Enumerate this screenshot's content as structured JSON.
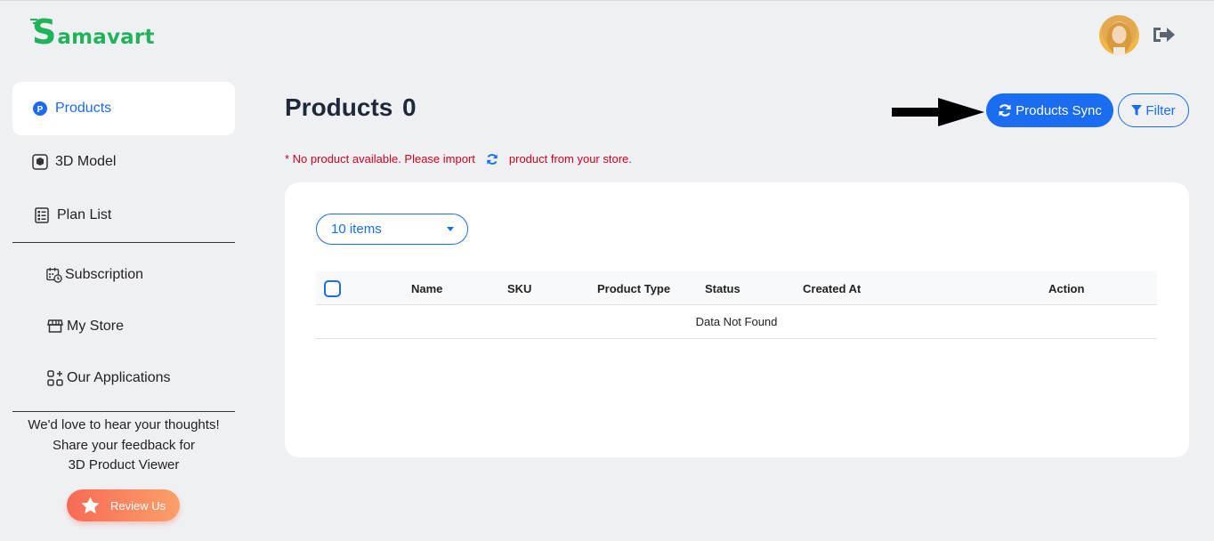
{
  "brand": {
    "logo_initial": "S",
    "logo_rest": "amavart",
    "color": "#1fb45a"
  },
  "header": {
    "avatar_icon": "user-avatar",
    "logout_icon": "logout-icon"
  },
  "sidebar": {
    "items": [
      {
        "label": "Products",
        "icon": "products-p-icon",
        "active": true
      },
      {
        "label": "3D Model",
        "icon": "cube-icon"
      },
      {
        "label": "Plan List",
        "icon": "list-icon"
      },
      {
        "label": "Subscription",
        "icon": "calendar-clock-icon"
      },
      {
        "label": "My Store",
        "icon": "store-icon"
      },
      {
        "label": "Our Applications",
        "icon": "apps-icon"
      }
    ],
    "feedback": {
      "line1": "We'd love to hear your thoughts!",
      "line2": "Share your feedback for",
      "line3": "3D Product Viewer"
    },
    "review_label": "Review Us"
  },
  "main": {
    "title": "Products",
    "count": "0",
    "sync_label": "Products Sync",
    "filter_label": "Filter",
    "notice_before": "* No product available. Please import",
    "notice_after": "product from your store.",
    "page_size": "10 items",
    "table": {
      "columns": [
        "Name",
        "SKU",
        "Product Type",
        "Status",
        "Created At",
        "Action"
      ],
      "empty_text": "Data Not Found"
    }
  },
  "colors": {
    "accent": "#1a6cf0",
    "error": "#d0021b",
    "review_start": "#f86a55",
    "review_end": "#fba06a"
  }
}
